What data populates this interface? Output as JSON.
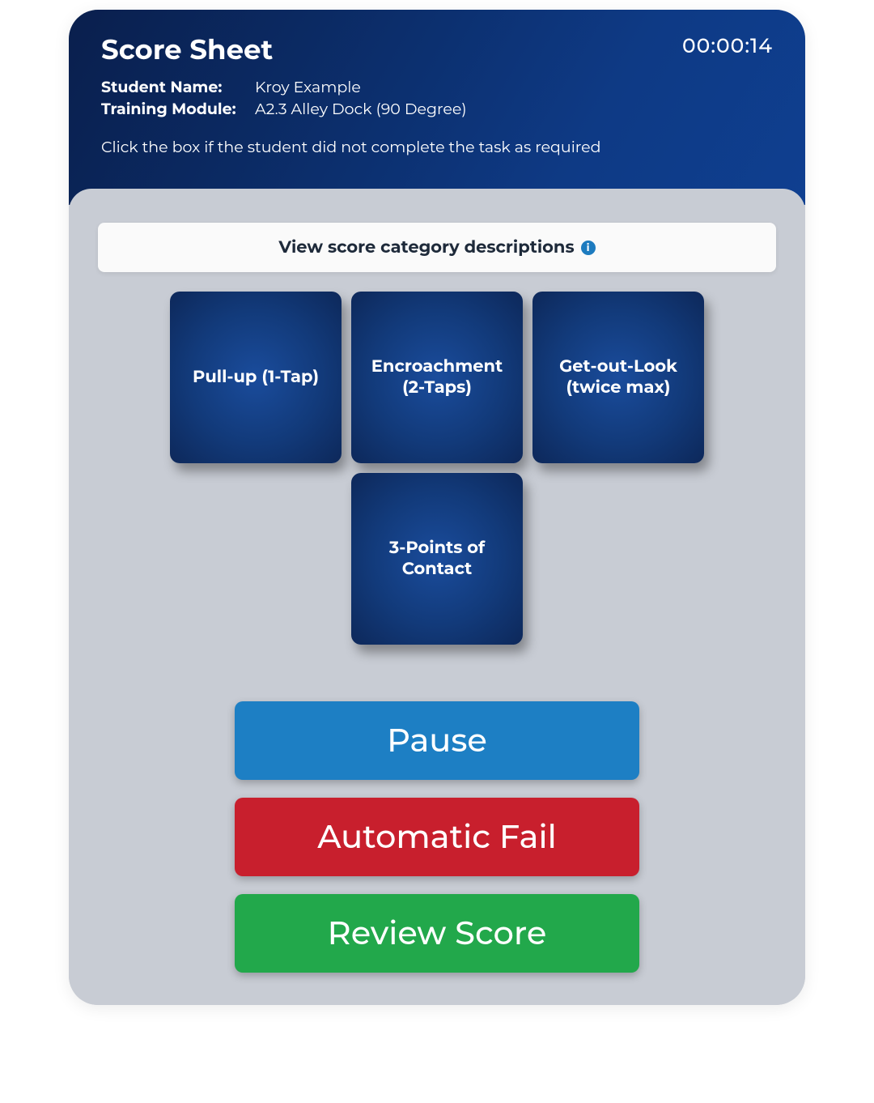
{
  "header": {
    "title": "Score Sheet",
    "timer": "00:00:14",
    "student_name_label": "Student Name:",
    "student_name_value": "Kroy Example",
    "module_label": "Training Module:",
    "module_value": "A2.3 Alley Dock (90 Degree)",
    "instruction": "Click the box if the student did not complete the task as required"
  },
  "descriptions_bar": {
    "label": "View score category descriptions",
    "icon_glyph": "i"
  },
  "tiles": {
    "0": "Pull-up (1-Tap)",
    "1": "Encroachment (2-Taps)",
    "2": "Get-out-Look (twice max)",
    "3": "3-Points of Contact"
  },
  "actions": {
    "pause": "Pause",
    "fail": "Automatic Fail",
    "review": "Review Score"
  },
  "colors": {
    "pause": "#1d7fc4",
    "fail": "#c81f2d",
    "review": "#22a84b",
    "tile_gradient_from": "#1a4c9c",
    "tile_gradient_to": "#0d285a",
    "body_bg": "#c8ccd4"
  }
}
